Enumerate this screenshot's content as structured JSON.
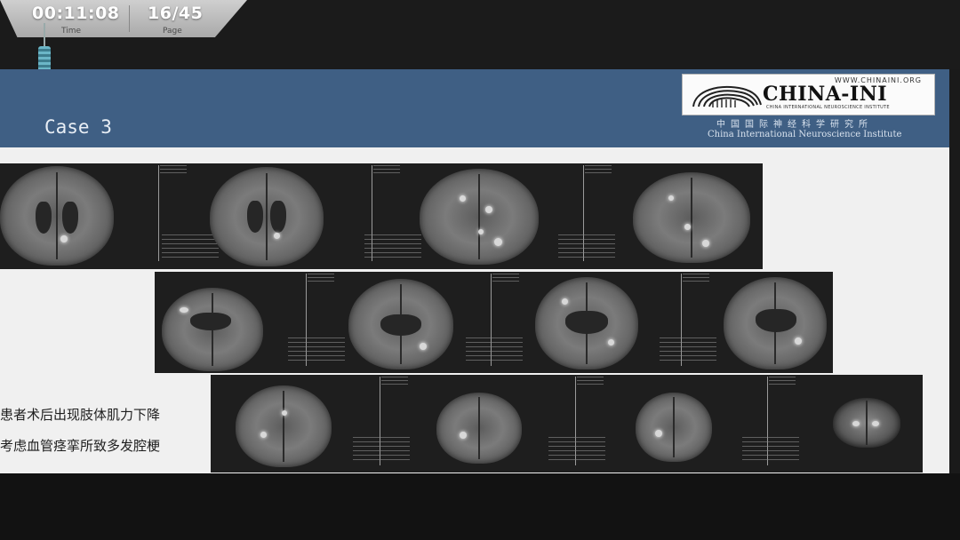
{
  "player": {
    "time_value": "00:11:08",
    "time_label": "Time",
    "page_value": "16/45",
    "page_label": "Page"
  },
  "slide": {
    "title": "Case 3",
    "logo": {
      "url": "WWW.CHINAINI.ORG",
      "name": "CHINA-INI",
      "subtitle": "CHINA INTERNATIONAL NEUROSCIENCE INSTITUTE",
      "cn_name": "中国国际神经科学研究所",
      "en_name": "China International Neuroscience Institute"
    },
    "captions": [
      "患者术后出现肢体肌力下降",
      "考虑血管痉挛所致多发腔梗"
    ]
  },
  "colors": {
    "header_blue": "#3f5f84",
    "slide_bg": "#f0f0f0",
    "mri_bg": "#1e1e1e"
  }
}
